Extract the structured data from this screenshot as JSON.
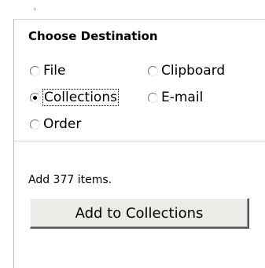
{
  "panel": {
    "title": "Choose Destination"
  },
  "destinations": {
    "file": {
      "label": "File",
      "selected": false
    },
    "clipboard": {
      "label": "Clipboard",
      "selected": false
    },
    "collections": {
      "label": "Collections",
      "selected": true
    },
    "email": {
      "label": "E-mail",
      "selected": false
    },
    "order": {
      "label": "Order",
      "selected": false
    }
  },
  "status": {
    "text": "Add 377 items."
  },
  "actions": {
    "add_button_label": "Add to Collections"
  }
}
